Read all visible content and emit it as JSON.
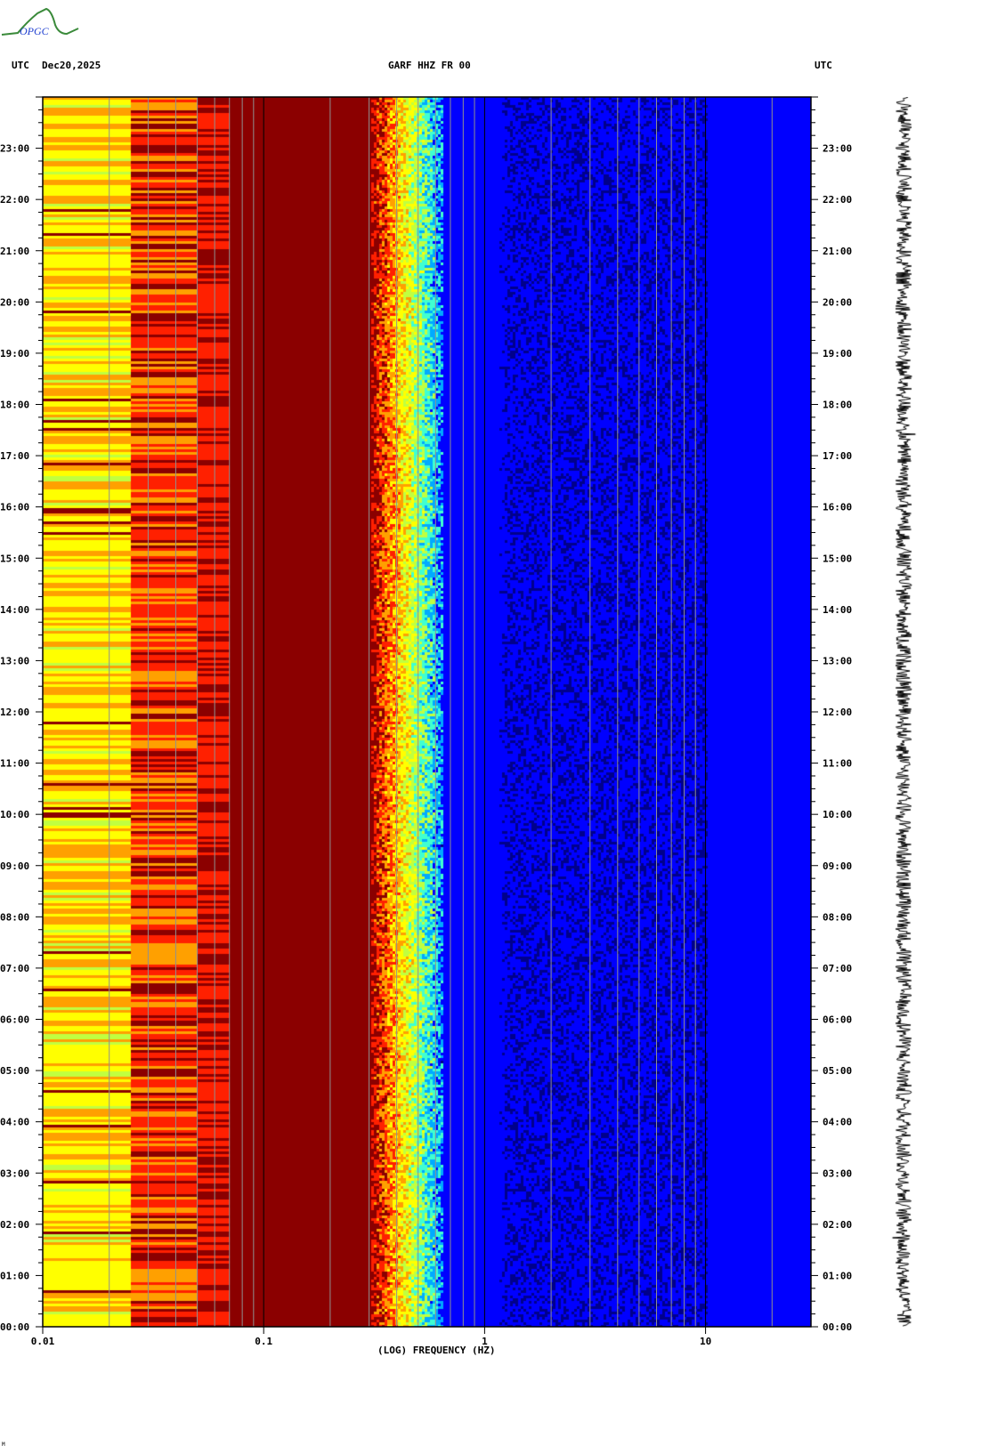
{
  "header": {
    "left_tz": "UTC",
    "date": "Dec20,2025",
    "station": "GARF HHZ FR 00",
    "right_tz": "UTC",
    "logo_text": "OPGC"
  },
  "footer_mark": "M",
  "chart_data": {
    "type": "heatmap",
    "title": "GARF HHZ FR 00",
    "xlabel": "(LOG) FREQUENCY (HZ)",
    "ylabel": "UTC",
    "x_scale": "log",
    "xlim": [
      0.01,
      30
    ],
    "ylim_hours": [
      0,
      24
    ],
    "x_ticks": [
      {
        "value": 0.01,
        "label": "0.01"
      },
      {
        "value": 0.1,
        "label": "0.1"
      },
      {
        "value": 1,
        "label": "1"
      },
      {
        "value": 10,
        "label": "10"
      }
    ],
    "y_ticks": [
      "00:00",
      "01:00",
      "02:00",
      "03:00",
      "04:00",
      "05:00",
      "06:00",
      "07:00",
      "08:00",
      "09:00",
      "10:00",
      "11:00",
      "12:00",
      "13:00",
      "14:00",
      "15:00",
      "16:00",
      "17:00",
      "18:00",
      "19:00",
      "20:00",
      "21:00",
      "22:00",
      "23:00"
    ],
    "colormap": [
      "#00008b",
      "#0000ff",
      "#00aaff",
      "#40ffd0",
      "#c0ff40",
      "#ffff00",
      "#ffa000",
      "#ff2000",
      "#8b0000"
    ],
    "grid": true
  }
}
